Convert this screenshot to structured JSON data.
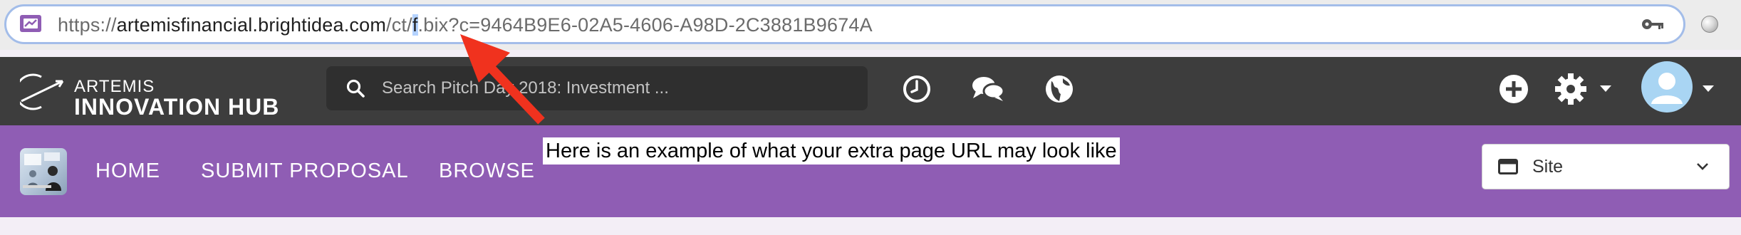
{
  "browser": {
    "url_prefix": "https://",
    "url_host": "artemisfinancial.brightidea.com",
    "url_path_a": "/ct/",
    "url_selected": "f",
    "url_rest": ".bix?c=9464B9E6-02A5-4606-A98D-2C3881B9674A"
  },
  "header": {
    "logo_line1": "ARTEMIS",
    "logo_line2": "INNOVATION HUB",
    "search_placeholder": "Search  Pitch Day 2018: Investment ..."
  },
  "subnav": {
    "items": [
      {
        "label": "HOME"
      },
      {
        "label": "SUBMIT PROPOSAL"
      },
      {
        "label": "BROWSE"
      }
    ],
    "site_select": {
      "label": "Site"
    }
  },
  "annotation": {
    "text": "Here is an example of what your extra page URL may look like",
    "arrow_color": "#f0321e"
  },
  "colors": {
    "topnav_bg": "#3d3d3d",
    "subnav_bg": "#8f5db4",
    "url_border": "#a3bde9"
  }
}
